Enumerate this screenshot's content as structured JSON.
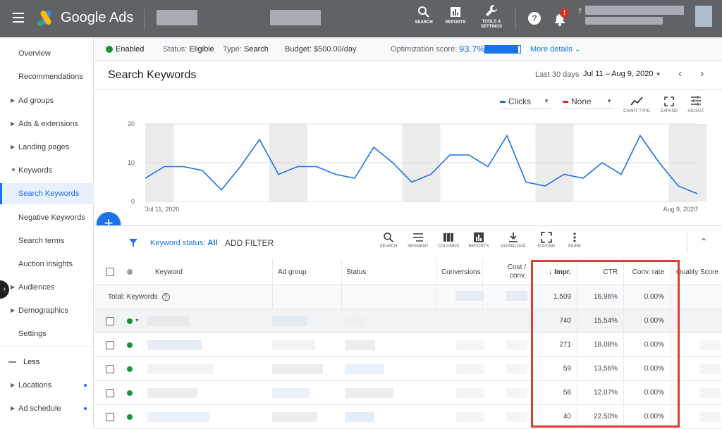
{
  "topbar": {
    "brand_google": "Google",
    "brand_ads": "Ads",
    "search_label": "SEARCH",
    "reports_label": "REPORTS",
    "tools_label_1": "TOOLS &",
    "tools_label_2": "SETTINGS",
    "notification_count": "!",
    "account_prefix": "7"
  },
  "sidebar": {
    "items": [
      {
        "label": "Overview",
        "caret": false
      },
      {
        "label": "Recommendations",
        "caret": false
      },
      {
        "label": "Ad groups",
        "caret": true
      },
      {
        "label": "Ads & extensions",
        "caret": true
      },
      {
        "label": "Landing pages",
        "caret": true
      },
      {
        "label": "Keywords",
        "caret": "open"
      },
      {
        "label": "Search Keywords",
        "active": true
      },
      {
        "label": "Negative Keywords"
      },
      {
        "label": "Search terms"
      },
      {
        "label": "Auction insights"
      },
      {
        "label": "Audiences",
        "caret": true
      },
      {
        "label": "Demographics",
        "caret": true
      },
      {
        "label": "Settings"
      },
      {
        "label": "Less"
      },
      {
        "label": "Locations",
        "caret": true,
        "dot": true
      },
      {
        "label": "Ad schedule",
        "caret": true,
        "dot": true
      }
    ]
  },
  "status": {
    "enabled": "Enabled",
    "status_label": "Status:",
    "status_value": "Eligible",
    "type_label": "Type:",
    "type_value": "Search",
    "budget": "Budget: $500.00/day",
    "opt_label": "Optimization score:",
    "opt_value": "93.7%",
    "opt_fraction": 0.937,
    "more_details": "More details"
  },
  "page": {
    "title": "Search Keywords",
    "date_range_label": "Last 30 days",
    "date_range": "Jul 11 – Aug 9, 2020"
  },
  "chart_controls": {
    "metric1": "Clicks",
    "metric2": "None",
    "chart_type": "CHART TYPE",
    "expand": "EXPAND",
    "adjust": "ADJUST"
  },
  "chart_data": {
    "type": "line",
    "series": [
      {
        "name": "Clicks",
        "color": "#1a73e8",
        "values": [
          6,
          9,
          9,
          8,
          3,
          9,
          16,
          7,
          9,
          9,
          7,
          6,
          14,
          10,
          5,
          7,
          12,
          12,
          9,
          17,
          5,
          4,
          7,
          6,
          10,
          7,
          17,
          10,
          4,
          2
        ]
      }
    ],
    "y_ticks": [
      "0",
      "10",
      "20"
    ],
    "ylim": [
      0,
      20
    ],
    "x_start_label": "Jul 11, 2020",
    "x_end_label": "Aug 9, 2020",
    "weekend_bands": true
  },
  "table_toolbar": {
    "filter_label": "Keyword status:",
    "filter_value": "All",
    "add_filter": "ADD FILTER",
    "buttons": [
      "SEARCH",
      "SEGMENT",
      "COLUMNS",
      "REPORTS",
      "DOWNLOAD",
      "EXPAND",
      "MORE"
    ]
  },
  "table": {
    "headers": {
      "keyword": "Keyword",
      "ad_group": "Ad group",
      "status": "Status",
      "conversions": "Conversions",
      "cost_conv_1": "Cost /",
      "cost_conv_2": "conv.",
      "impr": "Impr.",
      "ctr": "CTR",
      "conv_rate": "Conv. rate",
      "quality": "Quality Score"
    },
    "total": {
      "label": "Total: Keywords",
      "impr": "1,509",
      "ctr": "16.96%",
      "conv_rate": "0.00%"
    },
    "rows": [
      {
        "impr": "740",
        "ctr": "15.54%",
        "conv_rate": "0.00%"
      },
      {
        "impr": "271",
        "ctr": "18.08%",
        "conv_rate": "0.00%"
      },
      {
        "impr": "59",
        "ctr": "13.56%",
        "conv_rate": "0.00%"
      },
      {
        "impr": "58",
        "ctr": "12.07%",
        "conv_rate": "0.00%"
      },
      {
        "impr": "40",
        "ctr": "22.50%",
        "conv_rate": "0.00%"
      }
    ]
  }
}
